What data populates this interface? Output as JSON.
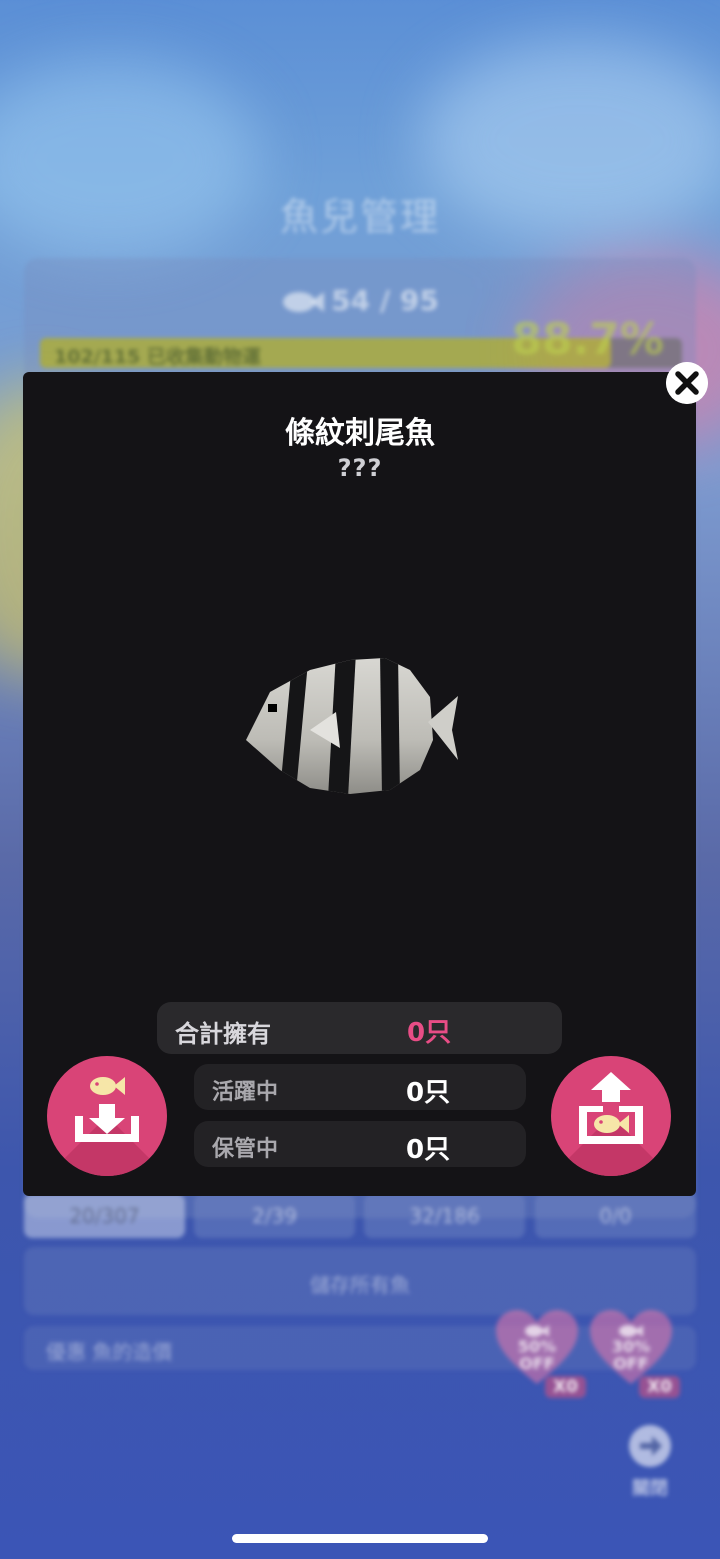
{
  "background": {
    "title": "魚兒管理",
    "fish_count": "54 / 95",
    "collection_text": "102/115 已收集動物運",
    "collection_percent": "88.7%",
    "collection_progress_fraction": 0.89,
    "tabs": [
      {
        "value": "20/307",
        "active": true
      },
      {
        "value": "2/39",
        "active": false
      },
      {
        "value": "32/186",
        "active": false
      },
      {
        "value": "0/0",
        "active": false
      }
    ],
    "save_all_label": "儲存所有魚",
    "discount_label": "優惠 魚的造價",
    "discounts": [
      {
        "percent": "50%",
        "off": "OFF",
        "count": "X0"
      },
      {
        "percent": "30%",
        "off": "OFF",
        "count": "X0"
      }
    ],
    "close_label": "關閉"
  },
  "modal": {
    "fish_name": "條紋刺尾魚",
    "fish_subtitle": "???",
    "stats": {
      "total_label": "合計擁有",
      "total_value": "0只",
      "active_label": "活躍中",
      "active_value": "0只",
      "stored_label": "保管中",
      "stored_value": "0只"
    },
    "icons": {
      "close": "close-icon",
      "store": "store-fish-icon",
      "release": "release-fish-icon"
    }
  },
  "colors": {
    "modal_bg": "#141316",
    "accent_pink": "#d94477",
    "total_value": "#e84d86"
  }
}
